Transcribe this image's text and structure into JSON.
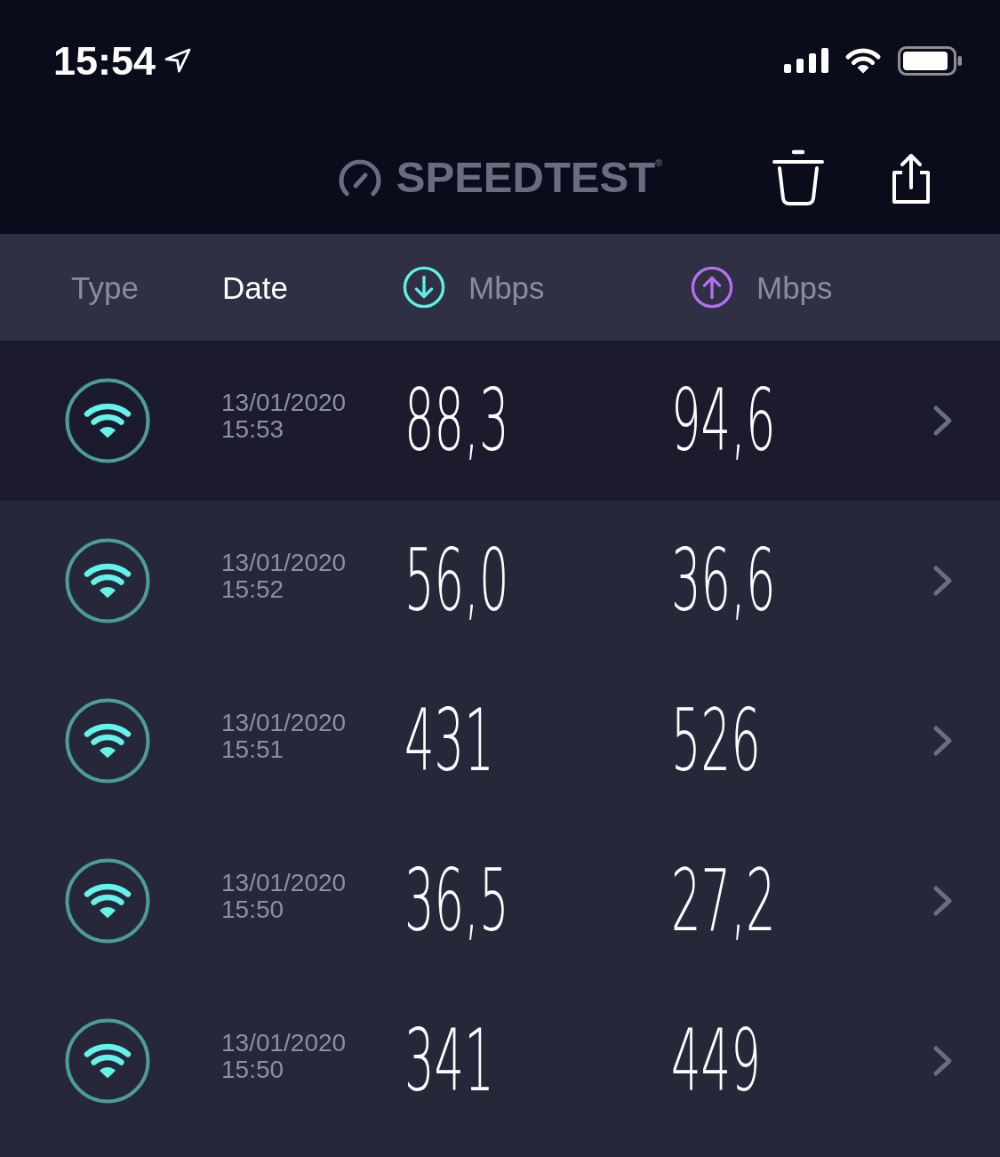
{
  "status_bar": {
    "time": "15:54"
  },
  "header": {
    "title": "SPEEDTEST$^{®}$"
  },
  "columns": [
    {
      "label": "Type",
      "kind": "plain",
      "selected": false
    },
    {
      "label": "Date",
      "kind": "plain",
      "selected": true
    },
    {
      "label": "Mbps",
      "kind": "download",
      "selected": false
    },
    {
      "label": "Mbps",
      "kind": "upload",
      "selected": false
    }
  ],
  "rows": [
    {
      "kind": "wifi",
      "date": "13/01/2020",
      "time": "15:53",
      "download": "88,3",
      "upload": "94,6",
      "selected": true
    },
    {
      "kind": "wifi",
      "date": "13/01/2020",
      "time": "15:52",
      "download": "56,0",
      "upload": "36,6",
      "selected": false
    },
    {
      "kind": "wifi",
      "date": "13/01/2020",
      "time": "15:51",
      "download": "431",
      "upload": "526",
      "selected": false
    },
    {
      "kind": "wifi",
      "date": "13/01/2020",
      "time": "15:50",
      "download": "36,5",
      "upload": "27,2",
      "selected": false
    },
    {
      "kind": "wifi",
      "date": "13/01/2020",
      "time": "15:50",
      "download": "341",
      "upload": "449",
      "selected": false
    }
  ]
}
